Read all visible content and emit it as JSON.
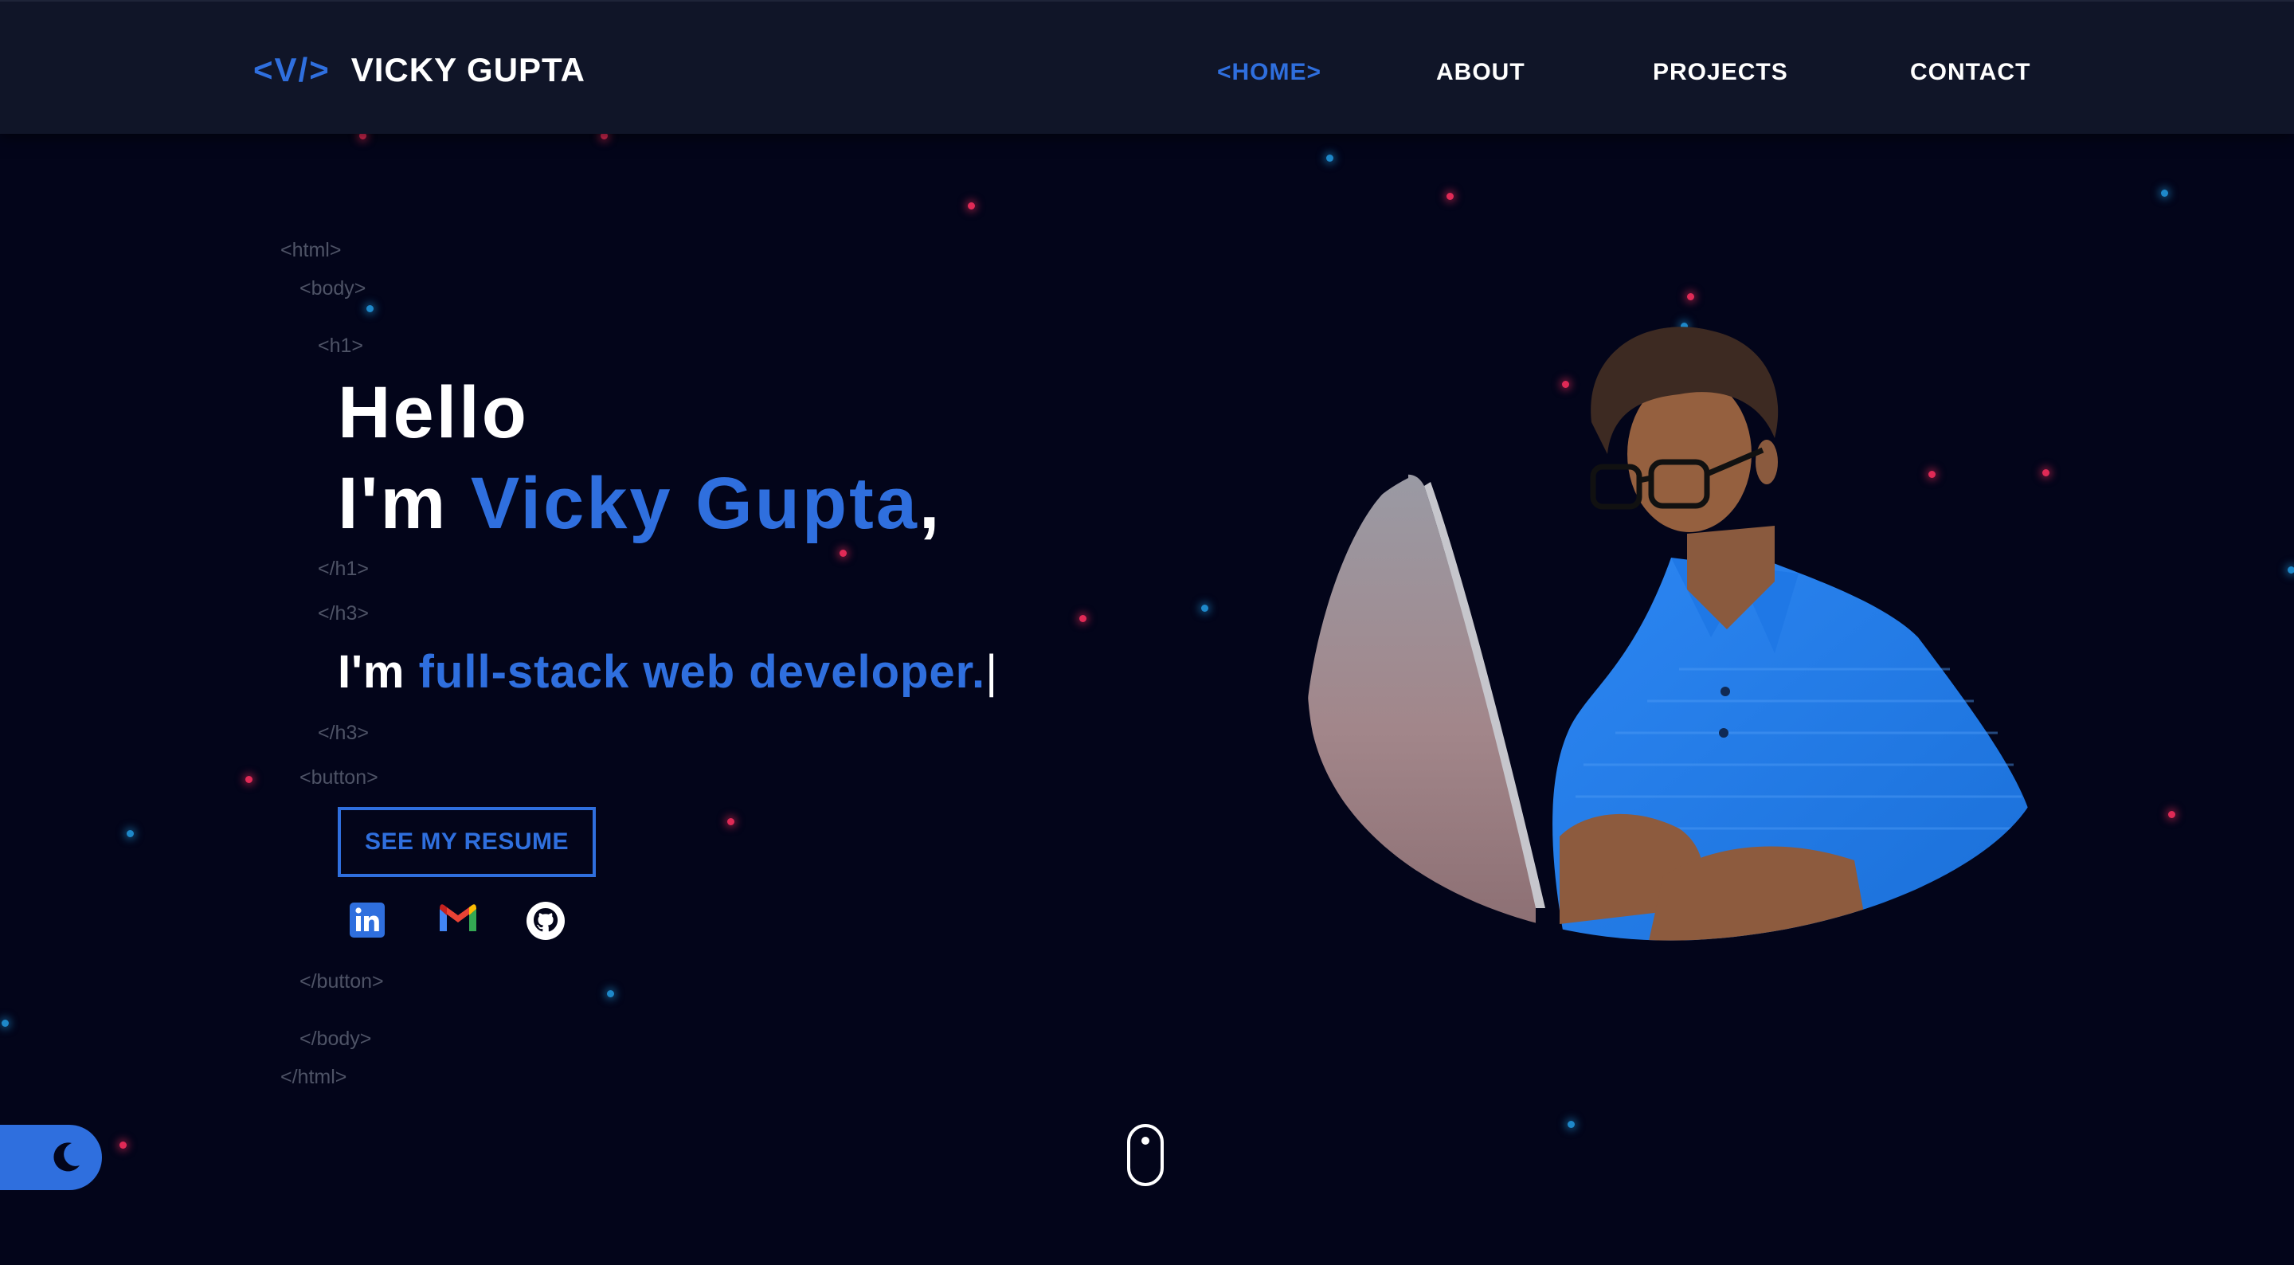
{
  "nav": {
    "brand_code": "<V/>",
    "brand_name": "VICKY GUPTA",
    "links": [
      {
        "label": "<HOME>",
        "active": true
      },
      {
        "label": "ABOUT",
        "active": false
      },
      {
        "label": "PROJECTS",
        "active": false
      },
      {
        "label": "CONTACT",
        "active": false
      }
    ]
  },
  "code_tags": {
    "html_open": "<html>",
    "body_open": "<body>",
    "h1_open": "<h1>",
    "h1_close": "</h1>",
    "h3_open": "</h3>",
    "h3_close": "</h3>",
    "button_open": "<button>",
    "button_close": "</button>",
    "body_close": "</body>",
    "html_close": "</html>"
  },
  "hero": {
    "greeting": "Hello",
    "intro_prefix": "I'm ",
    "name": "Vicky Gupta",
    "intro_suffix": ",",
    "role_prefix": "I'm ",
    "role": "full-stack web developer.",
    "typing_cursor": "|"
  },
  "resume_button": {
    "label": "SEE MY RESUME"
  },
  "social": [
    {
      "icon": "linkedin-icon"
    },
    {
      "icon": "gmail-icon"
    },
    {
      "icon": "github-icon"
    }
  ],
  "profile_image": {
    "description_icon": "profile-photo"
  },
  "theme_toggle": {
    "icon": "moon-icon"
  },
  "scroll_indicator": {
    "icon": "mouse-scroll-icon"
  },
  "colors": {
    "background": "#03051a",
    "navbar": "#101528",
    "accent": "#2f6fde",
    "text": "#ffffff",
    "code_tag": "#4e5366",
    "star_red": "#e02a56",
    "star_blue": "#1e88c9"
  }
}
